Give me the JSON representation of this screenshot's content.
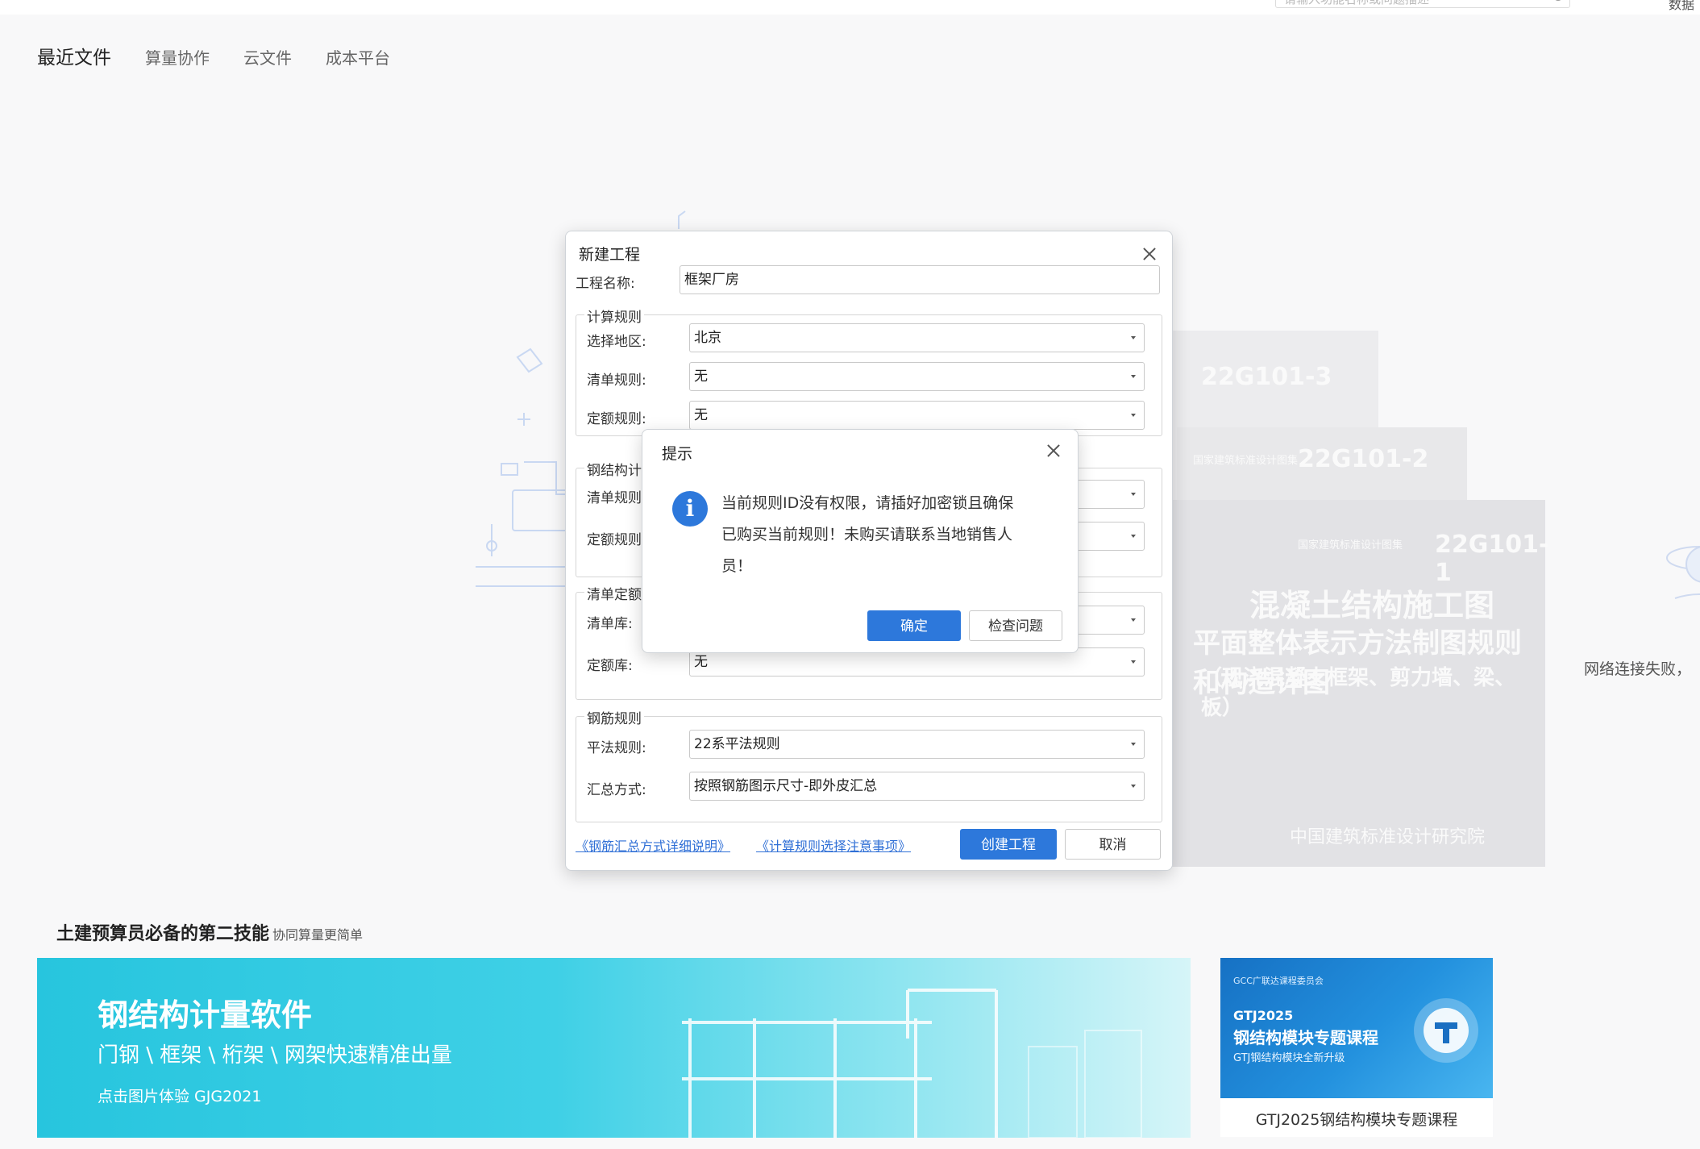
{
  "header": {
    "search_placeholder": "请输入功能名称或问题描述",
    "right_text": "数据"
  },
  "tabs": [
    {
      "label": "最近文件",
      "active": true
    },
    {
      "label": "算量协作",
      "active": false
    },
    {
      "label": "云文件",
      "active": false
    },
    {
      "label": "成本平台",
      "active": false
    }
  ],
  "background": {
    "book1_code": "22G101-3",
    "book2_series": "国家建筑标准设计图集",
    "book2_code": "22G101-2",
    "book3_series": "国家建筑标准设计图集",
    "book3_code": "22G101-1",
    "book3_title_1": "混凝土结构施工图",
    "book3_title_2": "平面整体表示方法制图规则和构造详图",
    "book3_title_3": "（现浇混凝土框架、剪力墙、梁、板）",
    "book3_publisher": "中国建筑标准设计研究院",
    "network_error": "网络连接失败，"
  },
  "new_project_dialog": {
    "title": "新建工程",
    "name_label": "工程名称:",
    "name_value": "框架厂房",
    "calc_rules": {
      "title": "计算规则",
      "region_label": "选择地区:",
      "region_value": "北京",
      "list_rule_label": "清单规则:",
      "list_rule_value": "无",
      "quota_rule_label": "定额规则:",
      "quota_rule_value": "无"
    },
    "steel_rules": {
      "title": "钢结构计",
      "list_rule_label": "清单规则",
      "quota_rule_label": "定额规则"
    },
    "library": {
      "title": "清单定额",
      "list_lib_label": "清单库:",
      "quota_lib_label": "定额库:",
      "quota_lib_value": "无"
    },
    "rebar_rules": {
      "title": "钢筋规则",
      "flat_rule_label": "平法规则:",
      "flat_rule_value": "22系平法规则",
      "summary_label": "汇总方式:",
      "summary_value": "按照钢筋图示尺寸-即外皮汇总"
    },
    "link_rebar": "《钢筋汇总方式详细说明》",
    "link_rules": "《计算规则选择注意事项》",
    "create_label": "创建工程",
    "cancel_label": "取消"
  },
  "alert_dialog": {
    "title": "提示",
    "message_lines": [
      "当前规则ID没有权限，请插好加密锁且确保",
      "已购买当前规则！未购买请联系当地销售人",
      "员！"
    ],
    "ok_label": "确定",
    "check_label": "检查问题"
  },
  "section": {
    "heading": "土建预算员必备的第二技能",
    "subheading": "协同算量更简单"
  },
  "banner": {
    "title": "钢结构计量软件",
    "subtitle": "门钢 \\ 框架 \\ 桁架 \\ 网架快速精准出量",
    "cta": "点击图片体验 GJG2021"
  },
  "course_card": {
    "org": "GCC广联达课程委员会",
    "code": "GTJ2025",
    "title": "钢结构模块专题课程",
    "subtitle": "GTJ钢结构模块全新升级",
    "caption": "GTJ2025钢结构模块专题课程"
  },
  "colors": {
    "primary": "#2d78db",
    "banner": "#27c5de",
    "link": "#2f6fd6"
  }
}
